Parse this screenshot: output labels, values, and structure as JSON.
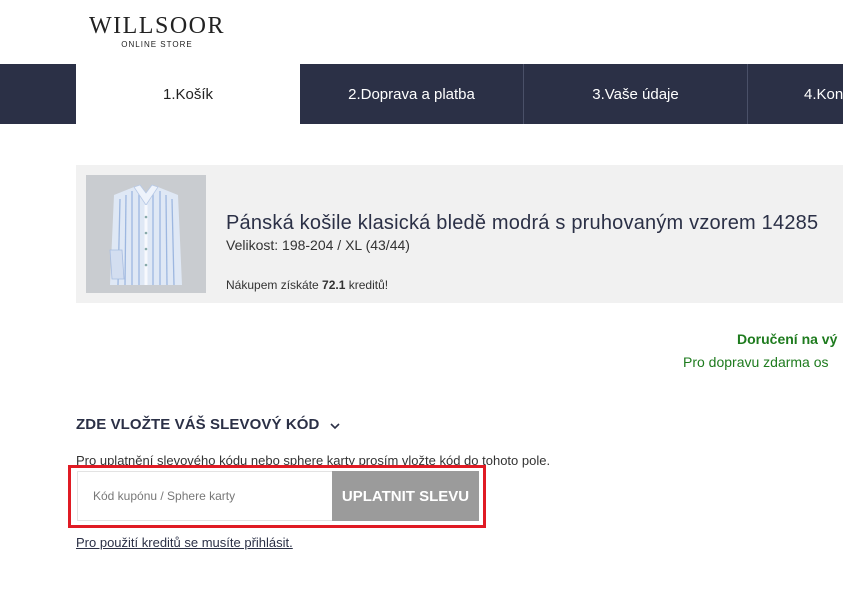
{
  "header": {
    "logo_main": "WILLSOOR",
    "logo_sub": "ONLINE STORE"
  },
  "steps": [
    {
      "label": "1.Košík",
      "active": true
    },
    {
      "label": "2.Doprava a platba",
      "active": false
    },
    {
      "label": "3.Vaše údaje",
      "active": false
    },
    {
      "label": "4.Kon",
      "active": false
    }
  ],
  "product": {
    "image_icon": "shirt-image",
    "name": "Pánská košile klasická bledě modrá s pruhovaným vzorem 14285",
    "size": "Velikost: 198-204 / XL (43/44)",
    "credits_prefix": "Nákupem získáte ",
    "credits_value": "72.1",
    "credits_suffix": " kreditů!"
  },
  "delivery": {
    "title": "Doručení na vý",
    "subtitle": "Pro dopravu zdarma os"
  },
  "coupon": {
    "title": "ZDE VLOŽTE VÁŠ SLEVOVÝ KÓD",
    "description": "Pro uplatnění slevového kódu nebo sphere karty prosím vložte kód do tohoto pole.",
    "input_value": "",
    "input_placeholder": "Kód kupónu / Sphere karty",
    "apply_label": "UPLATNIT SLEVU",
    "login_link": "Pro použití kreditů se musíte přihlásit."
  },
  "colors": {
    "nav_bg": "#2b3046",
    "highlight_frame": "#e01b24",
    "delivery_green": "#1e7b1e",
    "button_gray": "#9b9b9b"
  }
}
